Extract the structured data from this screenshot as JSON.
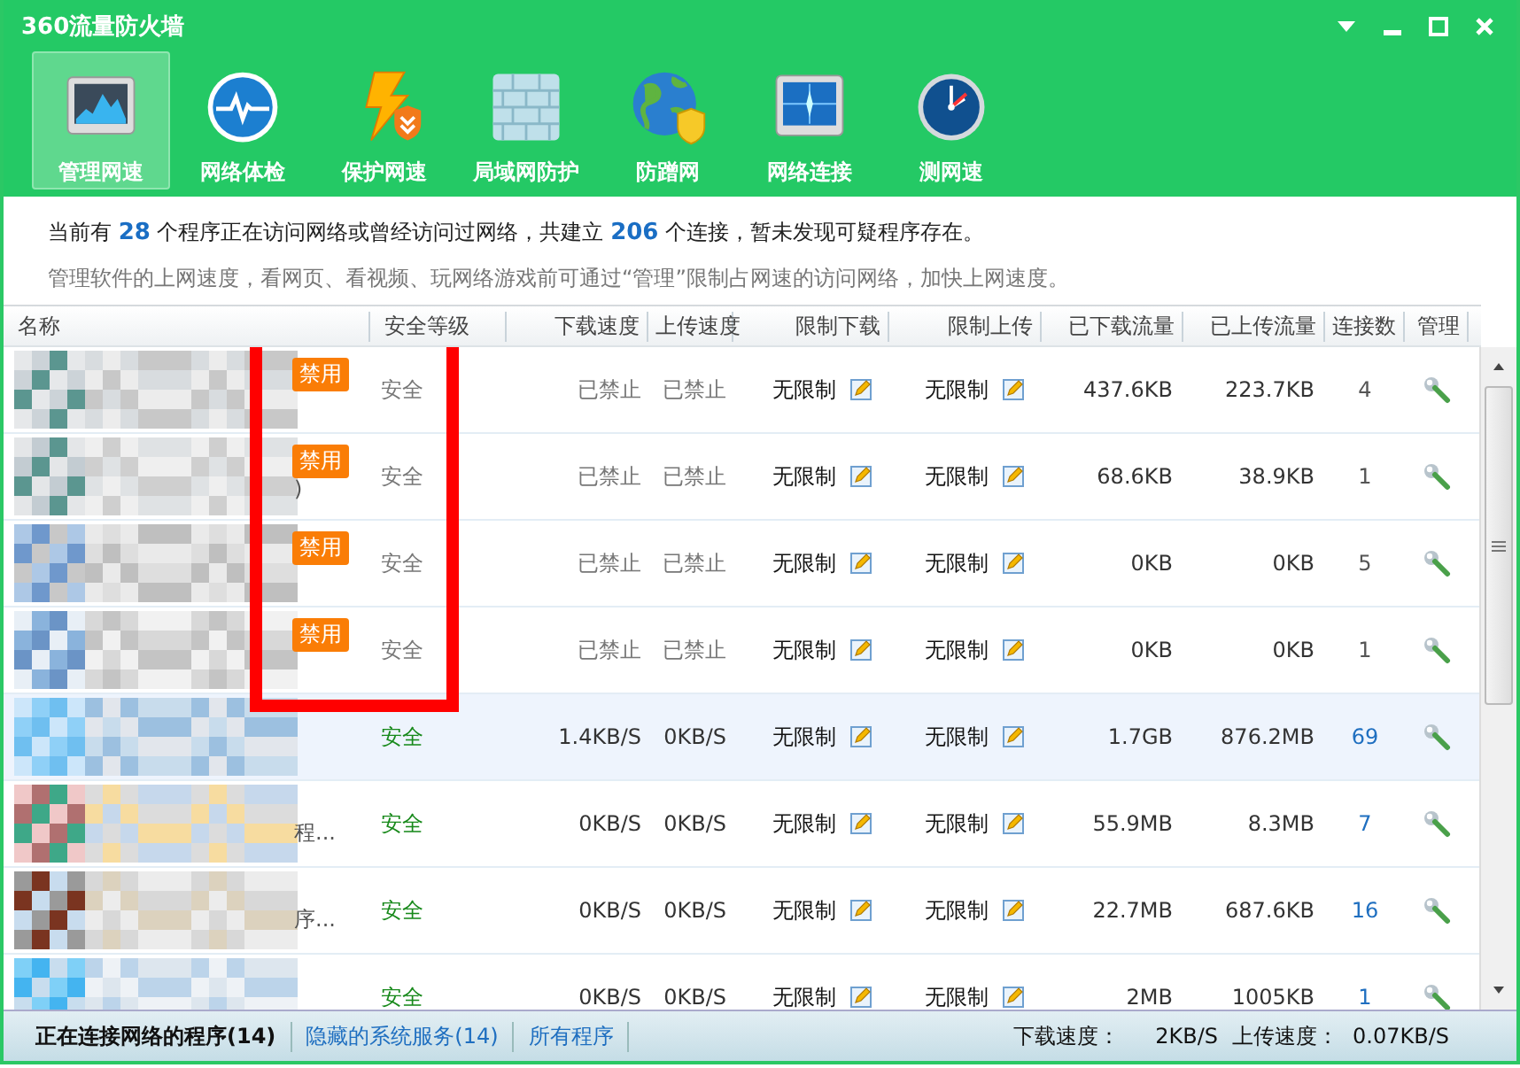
{
  "window": {
    "title": "360流量防火墙",
    "controls": [
      {
        "kind": "menu"
      },
      {
        "kind": "minimize"
      },
      {
        "kind": "maximize"
      },
      {
        "kind": "close"
      }
    ]
  },
  "toolbar": [
    {
      "label": "管理网速",
      "kind": "monitor-chart",
      "selected": true
    },
    {
      "label": "网络体检",
      "kind": "pulse",
      "selected": false
    },
    {
      "label": "保护网速",
      "kind": "bolt-shield",
      "selected": false
    },
    {
      "label": "局域网防护",
      "kind": "wall",
      "selected": false
    },
    {
      "label": "防蹭网",
      "kind": "globe-shield",
      "selected": false
    },
    {
      "label": "网络连接",
      "kind": "monitor-spark",
      "selected": false
    },
    {
      "label": "测网速",
      "kind": "gauge",
      "selected": false
    }
  ],
  "info": {
    "summary": "当前有 **28** 个程序正在访问网络或曾经访问过网络，共建立 **206** 个连接，暂未发现可疑程序存在。",
    "hint": "管理软件的上网速度，看网页、看视频、玩网络游戏前可通过“管理”限制占网速的访问网络，加快上网速度。"
  },
  "table": {
    "columns": [
      "名称",
      "安全等级",
      "下载速度",
      "上传速度",
      "限制下载",
      "限制上传",
      "已下载流量",
      "已上传流量",
      "连接数",
      "管理"
    ],
    "rows": [
      {
        "name": {
          "kind": "pixelated"
        },
        "badge": "禁用",
        "disabled": true,
        "selected": false,
        "security": "安全",
        "down": "已禁止",
        "up": "已禁止",
        "limit_down": "无限制",
        "limit_up": "无限制",
        "downloaded": "437.6KB",
        "uploaded": "223.7KB",
        "connections": "4"
      },
      {
        "name": {
          "kind": "pixelated",
          "fragment": ")"
        },
        "badge": "禁用",
        "disabled": true,
        "selected": false,
        "security": "安全",
        "down": "已禁止",
        "up": "已禁止",
        "limit_down": "无限制",
        "limit_up": "无限制",
        "downloaded": "68.6KB",
        "uploaded": "38.9KB",
        "connections": "1"
      },
      {
        "name": {
          "kind": "pixelated"
        },
        "badge": "禁用",
        "disabled": true,
        "selected": false,
        "security": "安全",
        "down": "已禁止",
        "up": "已禁止",
        "limit_down": "无限制",
        "limit_up": "无限制",
        "downloaded": "0KB",
        "uploaded": "0KB",
        "connections": "5"
      },
      {
        "name": {
          "kind": "pixelated"
        },
        "badge": "禁用",
        "disabled": true,
        "selected": false,
        "security": "安全",
        "down": "已禁止",
        "up": "已禁止",
        "limit_down": "无限制",
        "limit_up": "无限制",
        "downloaded": "0KB",
        "uploaded": "0KB",
        "connections": "1"
      },
      {
        "name": {
          "kind": "pixelated"
        },
        "disabled": false,
        "selected": true,
        "security": "安全",
        "down": "1.4KB/S",
        "up": "0KB/S",
        "limit_down": "无限制",
        "limit_up": "无限制",
        "downloaded": "1.7GB",
        "uploaded": "876.2MB",
        "connections": "69"
      },
      {
        "name": {
          "kind": "pixelated",
          "fragment": "程..."
        },
        "disabled": false,
        "selected": false,
        "security": "安全",
        "down": "0KB/S",
        "up": "0KB/S",
        "limit_down": "无限制",
        "limit_up": "无限制",
        "downloaded": "55.9MB",
        "uploaded": "8.3MB",
        "connections": "7"
      },
      {
        "name": {
          "kind": "pixelated",
          "fragment": "序..."
        },
        "disabled": false,
        "selected": false,
        "security": "安全",
        "down": "0KB/S",
        "up": "0KB/S",
        "limit_down": "无限制",
        "limit_up": "无限制",
        "downloaded": "22.7MB",
        "uploaded": "687.6KB",
        "connections": "16"
      },
      {
        "name": {
          "kind": "pixelated"
        },
        "disabled": false,
        "selected": false,
        "security": "安全",
        "down": "0KB/S",
        "up": "0KB/S",
        "limit_down": "无限制",
        "limit_up": "无限制",
        "downloaded": "2MB",
        "uploaded": "1005KB",
        "connections": "1"
      }
    ]
  },
  "annotation": {
    "kind": "rectangle"
  },
  "status_bar": {
    "tabs": [
      {
        "label": "正在连接网络的程序(14)",
        "selected": true
      },
      {
        "label": "隐藏的系统服务(14)",
        "selected": false
      },
      {
        "label": "所有程序",
        "selected": false
      }
    ],
    "download_label": "下载速度：",
    "download": "2KB/S",
    "upload_label": "上传速度：",
    "upload": "0.07KB/S"
  }
}
